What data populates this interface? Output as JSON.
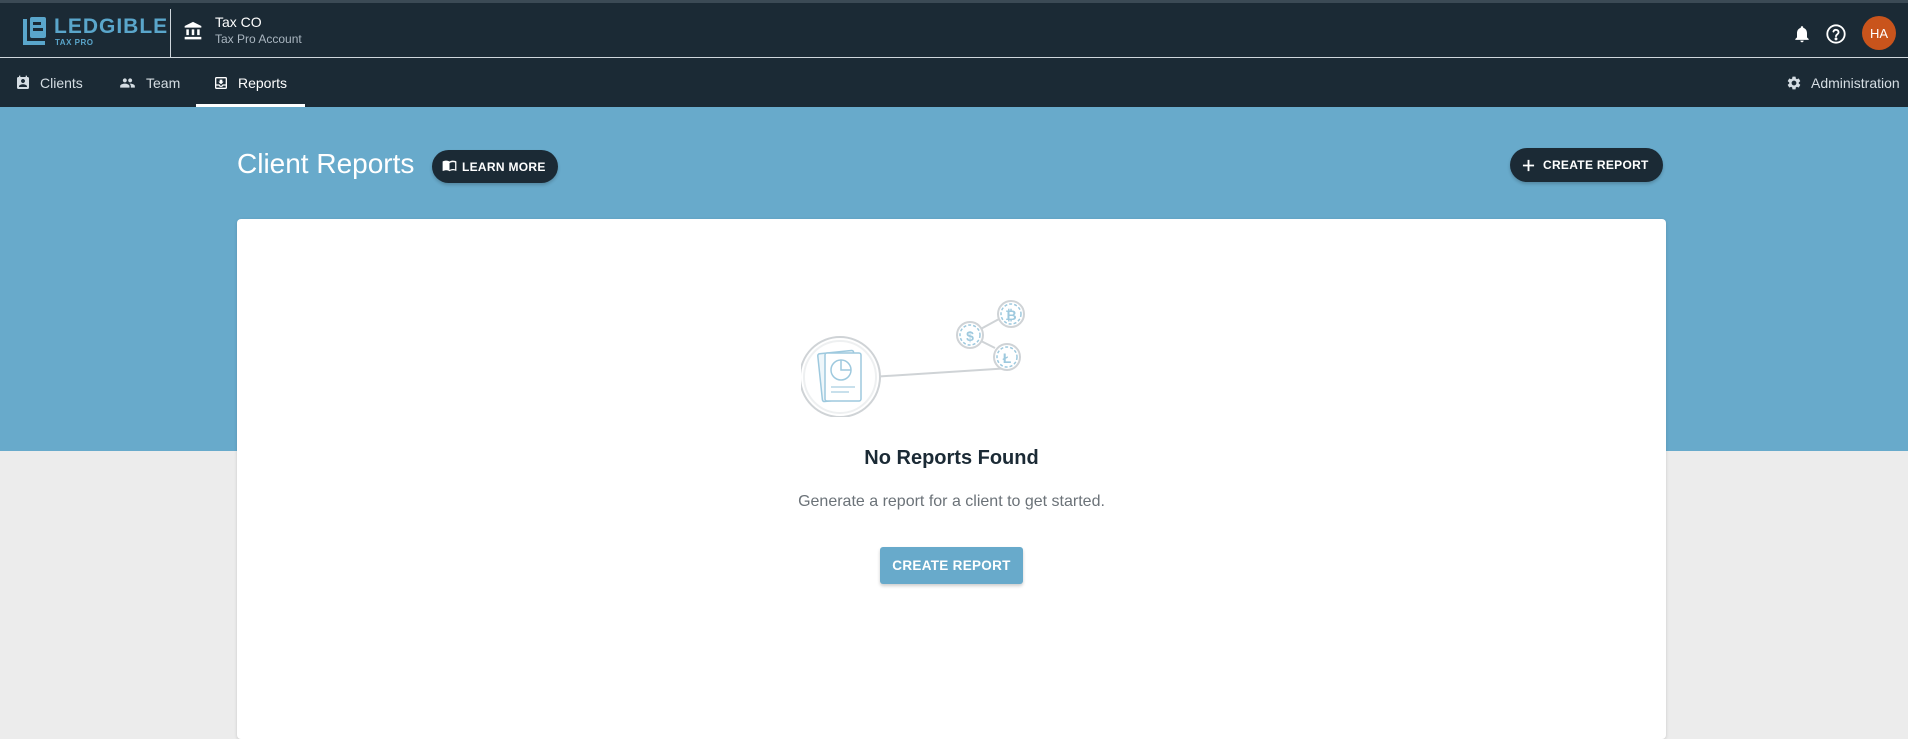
{
  "app": {
    "logo_text": "LEDGIBLE",
    "logo_subtext": "TAX PRO"
  },
  "account": {
    "name": "Tax CO",
    "type": "Tax Pro Account"
  },
  "header": {
    "avatar_initials": "HA",
    "avatar_color": "#c9541c"
  },
  "nav": {
    "items": [
      {
        "label": "Clients",
        "icon": "contact-book-icon"
      },
      {
        "label": "Team",
        "icon": "people-icon"
      },
      {
        "label": "Reports",
        "icon": "report-icon",
        "active": true
      }
    ],
    "admin_label": "Administration"
  },
  "page": {
    "title": "Client Reports",
    "learn_more_label": "LEARN MORE",
    "create_report_label": "CREATE REPORT"
  },
  "empty_state": {
    "title": "No Reports Found",
    "message": "Generate a report for a client to get started.",
    "button_label": "CREATE REPORT"
  },
  "colors": {
    "topbar": "#1b2a35",
    "accent": "#68aacb",
    "background": "#ececec"
  }
}
